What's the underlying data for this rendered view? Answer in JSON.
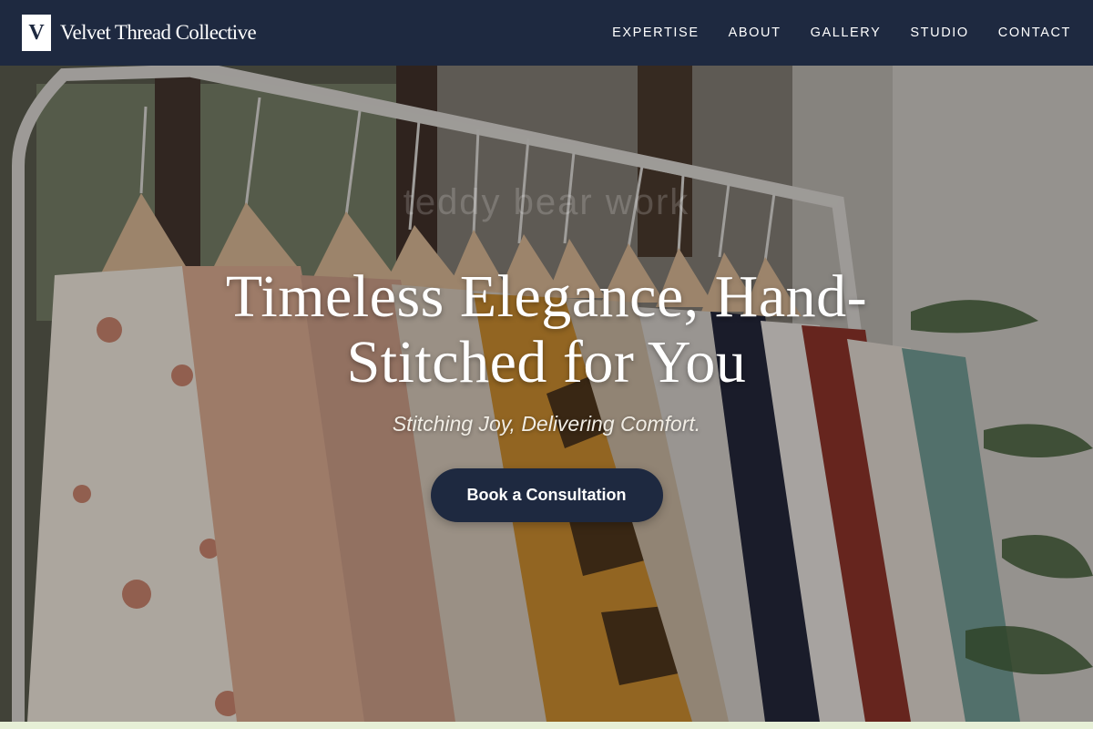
{
  "header": {
    "logo_letter": "V",
    "brand_name": "Velvet Thread Collective",
    "nav": [
      {
        "label": "EXPERTISE"
      },
      {
        "label": "ABOUT"
      },
      {
        "label": "GALLERY"
      },
      {
        "label": "STUDIO"
      },
      {
        "label": "CONTACT"
      }
    ]
  },
  "hero": {
    "title": "Timeless Elegance, Hand-Stitched for You",
    "watermark": "teddy bear work",
    "subtitle": "Stitching Joy, Delivering Comfort.",
    "cta_label": "Book a Consultation",
    "image_subject": "clothing-rack-with-hanging-garments"
  },
  "colors": {
    "navy": "#1e2940",
    "white": "#ffffff",
    "footer_strip": "#e6efd6"
  }
}
